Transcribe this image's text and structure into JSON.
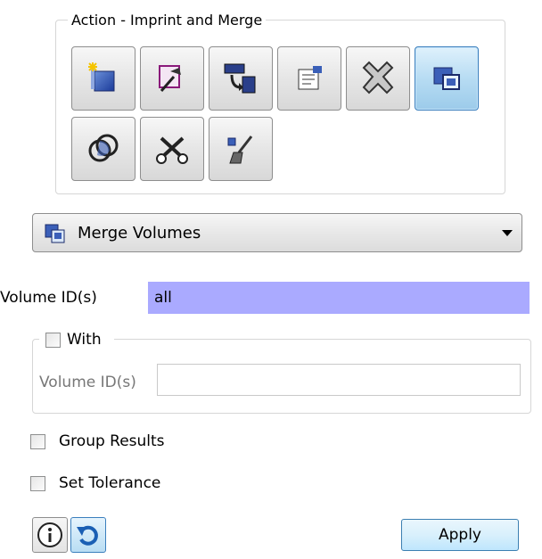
{
  "action_group": {
    "title": "Action - Imprint and Merge",
    "tools": [
      {
        "icon": "new-volume-icon",
        "active": false
      },
      {
        "icon": "imprint-tool-icon",
        "active": false
      },
      {
        "icon": "copy-transform-icon",
        "active": false
      },
      {
        "icon": "properties-icon",
        "active": false
      },
      {
        "icon": "remove-x-icon",
        "active": false
      },
      {
        "icon": "merge-volumes-icon",
        "active": true
      },
      {
        "icon": "intersect-icon",
        "active": false
      },
      {
        "icon": "unmerge-scissors-icon",
        "active": false
      },
      {
        "icon": "cleanup-brush-icon",
        "active": false
      }
    ]
  },
  "operation_select": {
    "value": "Merge Volumes"
  },
  "volume_ids": {
    "label": "Volume ID(s)",
    "value": "all"
  },
  "with_group": {
    "label": "With",
    "checked": false,
    "volume_ids_label": "Volume ID(s)",
    "volume_ids_value": ""
  },
  "options": {
    "group_results": "Group Results",
    "set_tolerance": "Set Tolerance"
  },
  "footer": {
    "apply_label": "Apply"
  },
  "colors": {
    "selection": "#aaaaff",
    "active_button": "#b7dcf3",
    "group_border": "#d6d6d6"
  }
}
